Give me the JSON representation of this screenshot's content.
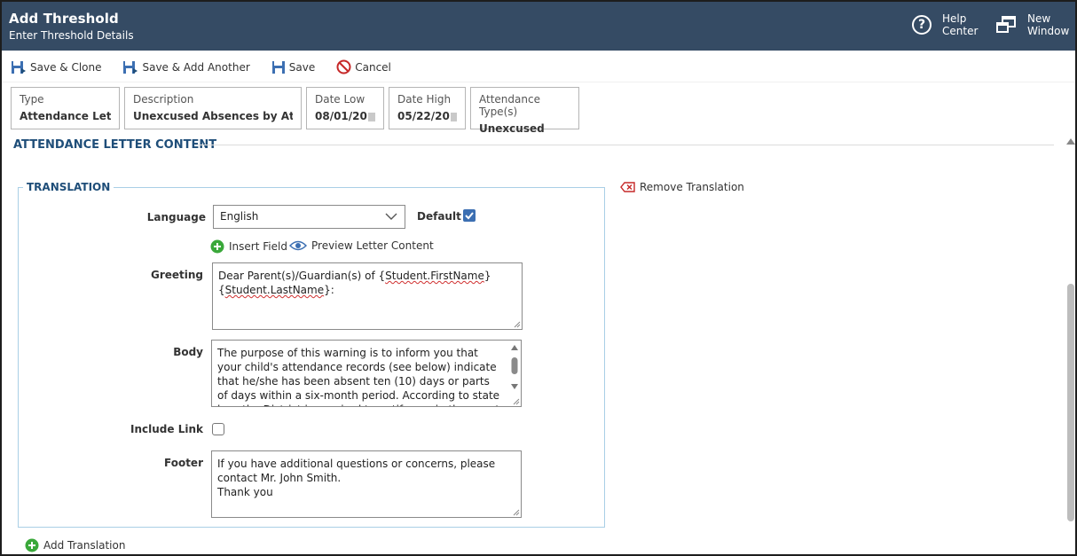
{
  "header": {
    "title": "Add Threshold",
    "subtitle": "Enter Threshold Details",
    "help_label": [
      "Help",
      "Center"
    ],
    "new_window_label": [
      "New",
      "Window"
    ]
  },
  "toolbar": {
    "save_clone": "Save & Clone",
    "save_add_another": "Save & Add Another",
    "save": "Save",
    "cancel": "Cancel"
  },
  "summary": {
    "type_caption": "Type",
    "type_value": "Attendance Letter",
    "description_caption": "Description",
    "description_value": "Unexcused Absences by Atte...",
    "date_low_caption": "Date Low",
    "date_low_value": "08/01/20",
    "date_high_caption": "Date High",
    "date_high_value": "05/22/20",
    "att_type_caption": "Attendance Type(s)",
    "att_type_value": "Unexcused"
  },
  "section": {
    "title": "ATTENDANCE LETTER CONTENT"
  },
  "translation": {
    "title": "TRANSLATION",
    "remove_label": "Remove Translation",
    "language_label": "Language",
    "language_value": "English",
    "default_label": "Default",
    "default_checked": true,
    "insert_field": "Insert Field",
    "preview": "Preview Letter Content",
    "greeting_label": "Greeting",
    "greeting_pre": "Dear Parent(s)/Guardian(s) of {",
    "greeting_field1": "Student.FirstName",
    "greeting_mid": "} {",
    "greeting_field2": "Student.LastName",
    "greeting_post": "}:",
    "body_label": "Body",
    "body_text": "The purpose of this warning is to inform you that your child's attendance records (see below) indicate that he/she has been absent ten (10) days or parts of days within a six-month period. According to state law, the District is required to notify you in the event of this much absence.",
    "include_link_label": "Include Link",
    "include_link_checked": false,
    "footer_label": "Footer",
    "footer_line1": "If you have additional questions or concerns, please contact Mr. John Smith.",
    "footer_line2": "Thank you"
  },
  "add_translation": "Add Translation",
  "colors": {
    "header_bg": "#354b64",
    "accent_blue": "#1f4e79",
    "check_blue": "#3c6fb2",
    "green_plus": "#3aa83a",
    "cancel_red": "#c62828"
  }
}
